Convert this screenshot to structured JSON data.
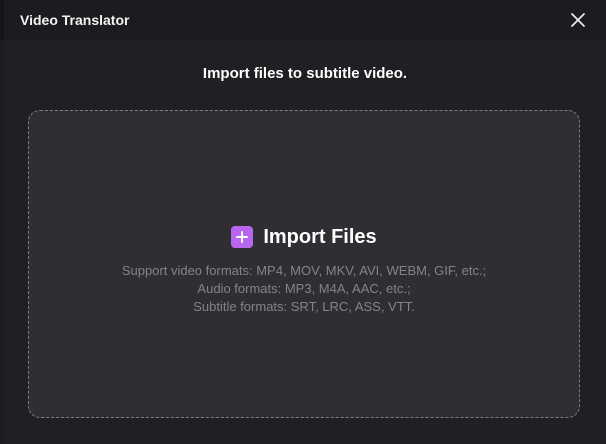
{
  "window": {
    "title": "Video Translator"
  },
  "heading": "Import files to subtitle video.",
  "dropzone": {
    "import_label": "Import Files",
    "formats": [
      "Support video formats: MP4, MOV, MKV, AVI, WEBM, GIF, etc.;",
      "Audio formats: MP3, M4A, AAC, etc.;",
      "Subtitle formats: SRT, LRC, ASS, VTT."
    ]
  },
  "icons": {
    "close": "close-icon",
    "plus": "plus-icon"
  },
  "colors": {
    "accent": "#b866f0",
    "dialog_bg": "#202024",
    "dropzone_bg": "#2e2e33",
    "muted_text": "#83838b"
  }
}
